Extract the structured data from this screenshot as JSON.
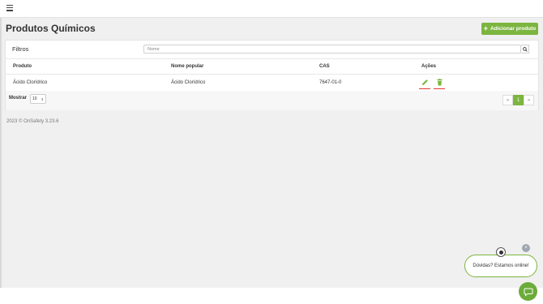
{
  "header": {
    "menu_icon": "hamburger-icon"
  },
  "page": {
    "title": "Produtos Químicos"
  },
  "toolbar": {
    "add_label": "Adicionar produto",
    "add_icon": "plus-icon"
  },
  "filters": {
    "label": "Filtros",
    "search_placeholder": "Nome",
    "search_icon": "search-icon"
  },
  "table": {
    "columns": [
      "Produto",
      "Nome popular",
      "CAS",
      "Ações"
    ],
    "rows": [
      {
        "produto": "Ácido Clorídrico",
        "nome_popular": "Ácido Clorídrico",
        "cas": "7647-01-0"
      }
    ],
    "actions": {
      "edit_icon": "pencil-icon",
      "delete_icon": "trash-icon"
    }
  },
  "pagination": {
    "show_label": "Mostrar",
    "page_size": "10",
    "prev": "«",
    "current": "1",
    "next": "»"
  },
  "footer": {
    "copyright": "2023 © OnSafety 3.23.6"
  },
  "chat": {
    "message": "Dúvidas? Estamos online!",
    "close": "×"
  },
  "colors": {
    "accent": "#7cb53f",
    "danger_underline": "#e53935"
  }
}
